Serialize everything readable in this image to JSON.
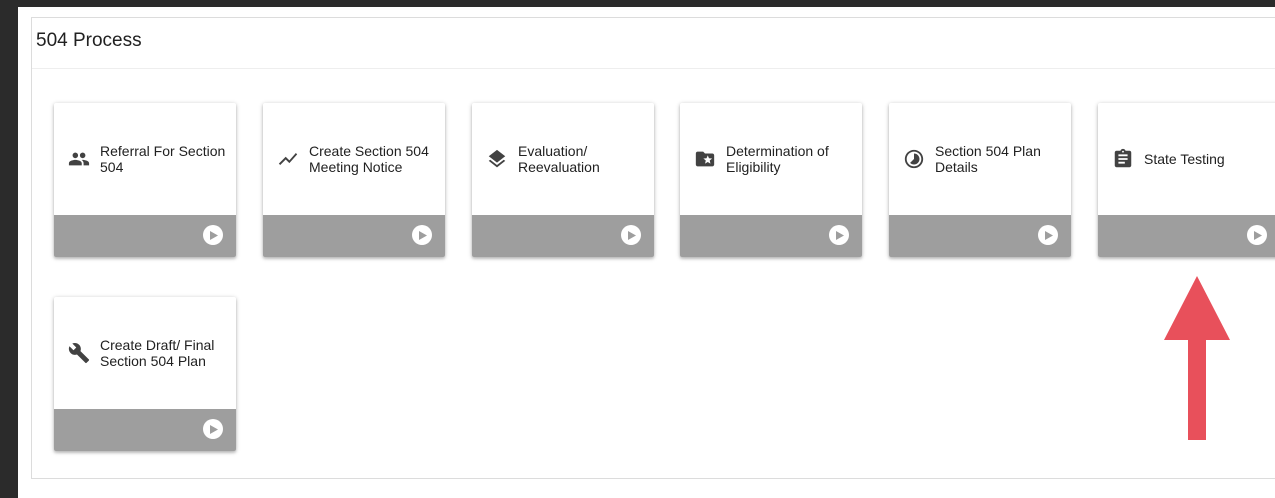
{
  "panel": {
    "title": "504 Process"
  },
  "cards": [
    {
      "label": "Referral For Section 504",
      "icon": "people-icon"
    },
    {
      "label": "Create Section 504 Meeting Notice",
      "icon": "trending-icon"
    },
    {
      "label": "Evaluation/ Reevaluation",
      "icon": "layers-icon"
    },
    {
      "label": "Determination of Eligibility",
      "icon": "folder-star-icon"
    },
    {
      "label": "Section 504 Plan Details",
      "icon": "clock-chart-icon"
    },
    {
      "label": "State Testing",
      "icon": "clipboard-icon"
    },
    {
      "label": "Create Draft/ Final Section 504 Plan",
      "icon": "wrench-icon"
    }
  ],
  "annotation": {
    "arrow_color": "#e8505b",
    "target": "State Testing"
  },
  "colors": {
    "card_footer": "#9e9e9e",
    "frame": "#2b2b2b"
  }
}
